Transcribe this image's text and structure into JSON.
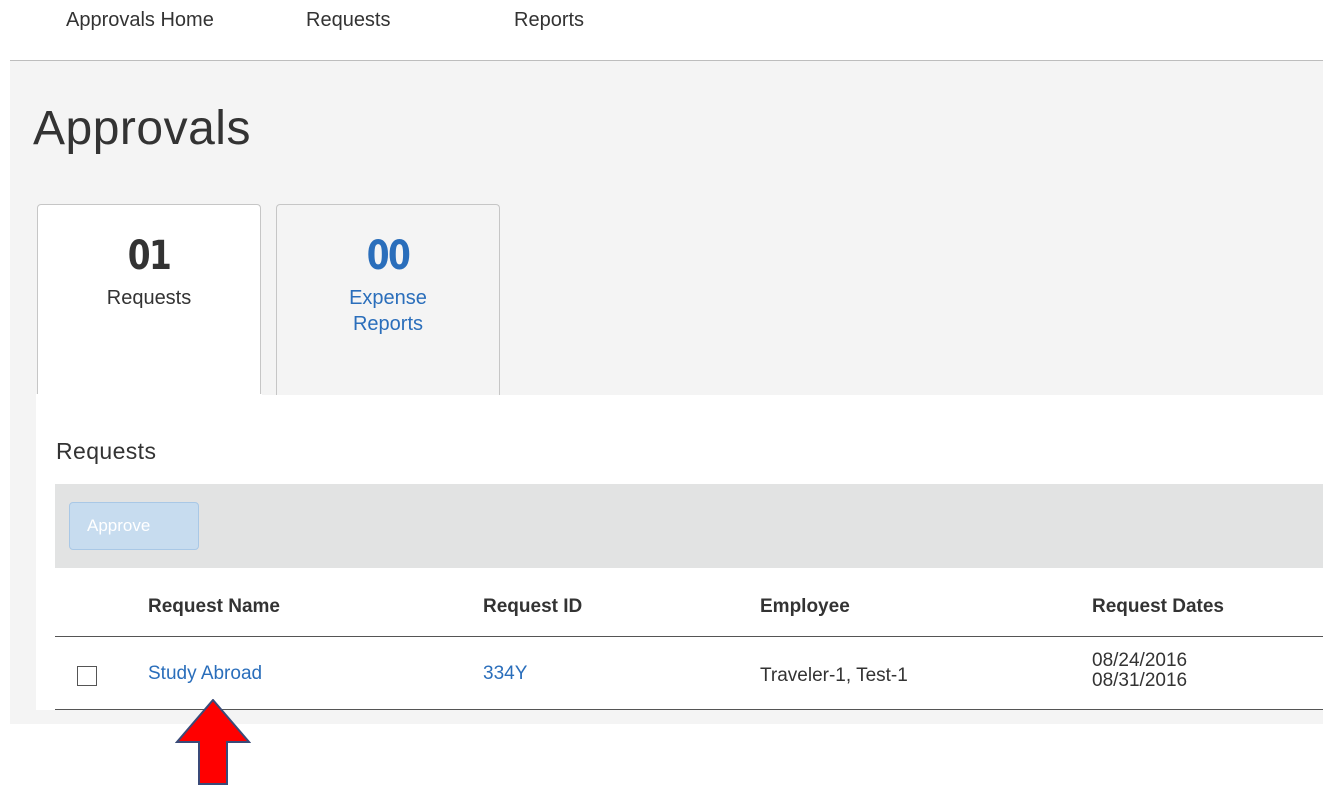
{
  "topnav": {
    "items": [
      "Approvals Home",
      "Requests",
      "Reports"
    ]
  },
  "page": {
    "title": "Approvals"
  },
  "tabs": [
    {
      "count": "01",
      "label": "Requests",
      "active": true
    },
    {
      "count": "00",
      "label": "Expense Reports",
      "active": false
    }
  ],
  "section": {
    "title": "Requests",
    "approve_label": "Approve"
  },
  "table": {
    "columns": [
      "Request Name",
      "Request ID",
      "Employee",
      "Request Dates"
    ],
    "rows": [
      {
        "name": "Study Abroad",
        "id": "334Y",
        "employee": "Traveler-1, Test-1",
        "date_start": "08/24/2016",
        "date_end": "08/31/2016"
      }
    ]
  },
  "colors": {
    "link": "#2a6ebb",
    "arrow": "#ff0000",
    "toolbar": "#e2e3e3"
  },
  "icons": {
    "annotation": "red-up-arrow-icon"
  }
}
